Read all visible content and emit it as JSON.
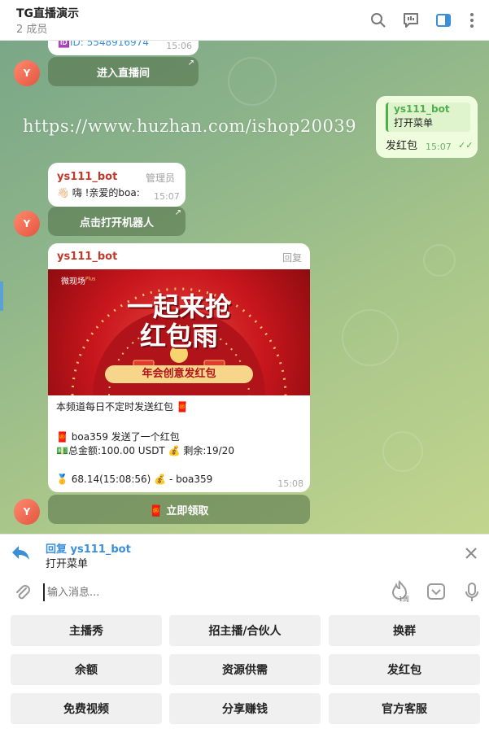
{
  "header": {
    "title": "TG直播演示",
    "subtitle": "2 成员"
  },
  "messages": {
    "m1": {
      "id_text": "🆔ID: 5548916974",
      "time": "15:06",
      "button": "进入直播间"
    },
    "m2": {
      "sender": "ys111_bot",
      "line1": "打开菜单",
      "line2": "发红包",
      "time": "15:07"
    },
    "m3": {
      "sender": "ys111_bot",
      "role": "管理员",
      "text": "👋🏻 嗨 !亲爱的boa:",
      "time": "15:07",
      "button": "点击打开机器人"
    },
    "m4": {
      "sender": "ys111_bot",
      "reply_label": "回复",
      "banner": {
        "brand": "微现场",
        "brand_sup": "Plus",
        "headline1": "一起来抢",
        "headline2": "红包雨",
        "ribbon": "年会创意发红包"
      },
      "line1": "本频道每日不定时发送红包 🧧",
      "line2": "🧧 boa359 发送了一个红包",
      "line3": "💵总金额:100.00 USDT 💰 剩余:19/20",
      "line4": "🥇 68.14(15:08:56) 💰 - boa359",
      "time": "15:08",
      "button": "🧧 立即领取"
    },
    "avatar_letter": "Y"
  },
  "watermark": "https://www.huzhan.com/ishop20039",
  "reply_bar": {
    "title": "回复 ys111_bot",
    "text": "打开菜单"
  },
  "composer": {
    "placeholder": "输入消息...",
    "boost_label": "1周"
  },
  "keyboard": {
    "row1": [
      "主播秀",
      "招主播/合伙人",
      "换群"
    ],
    "row2": [
      "余额",
      "资源供需",
      "发红包"
    ],
    "row3": [
      "免费视频",
      "分享赚钱",
      "官方客服"
    ]
  },
  "colors": {
    "accent": "#3a8fd8",
    "bot_name": "#c0392b",
    "outgoing_bubble": "#effdde",
    "banner_red": "#c8161d"
  }
}
